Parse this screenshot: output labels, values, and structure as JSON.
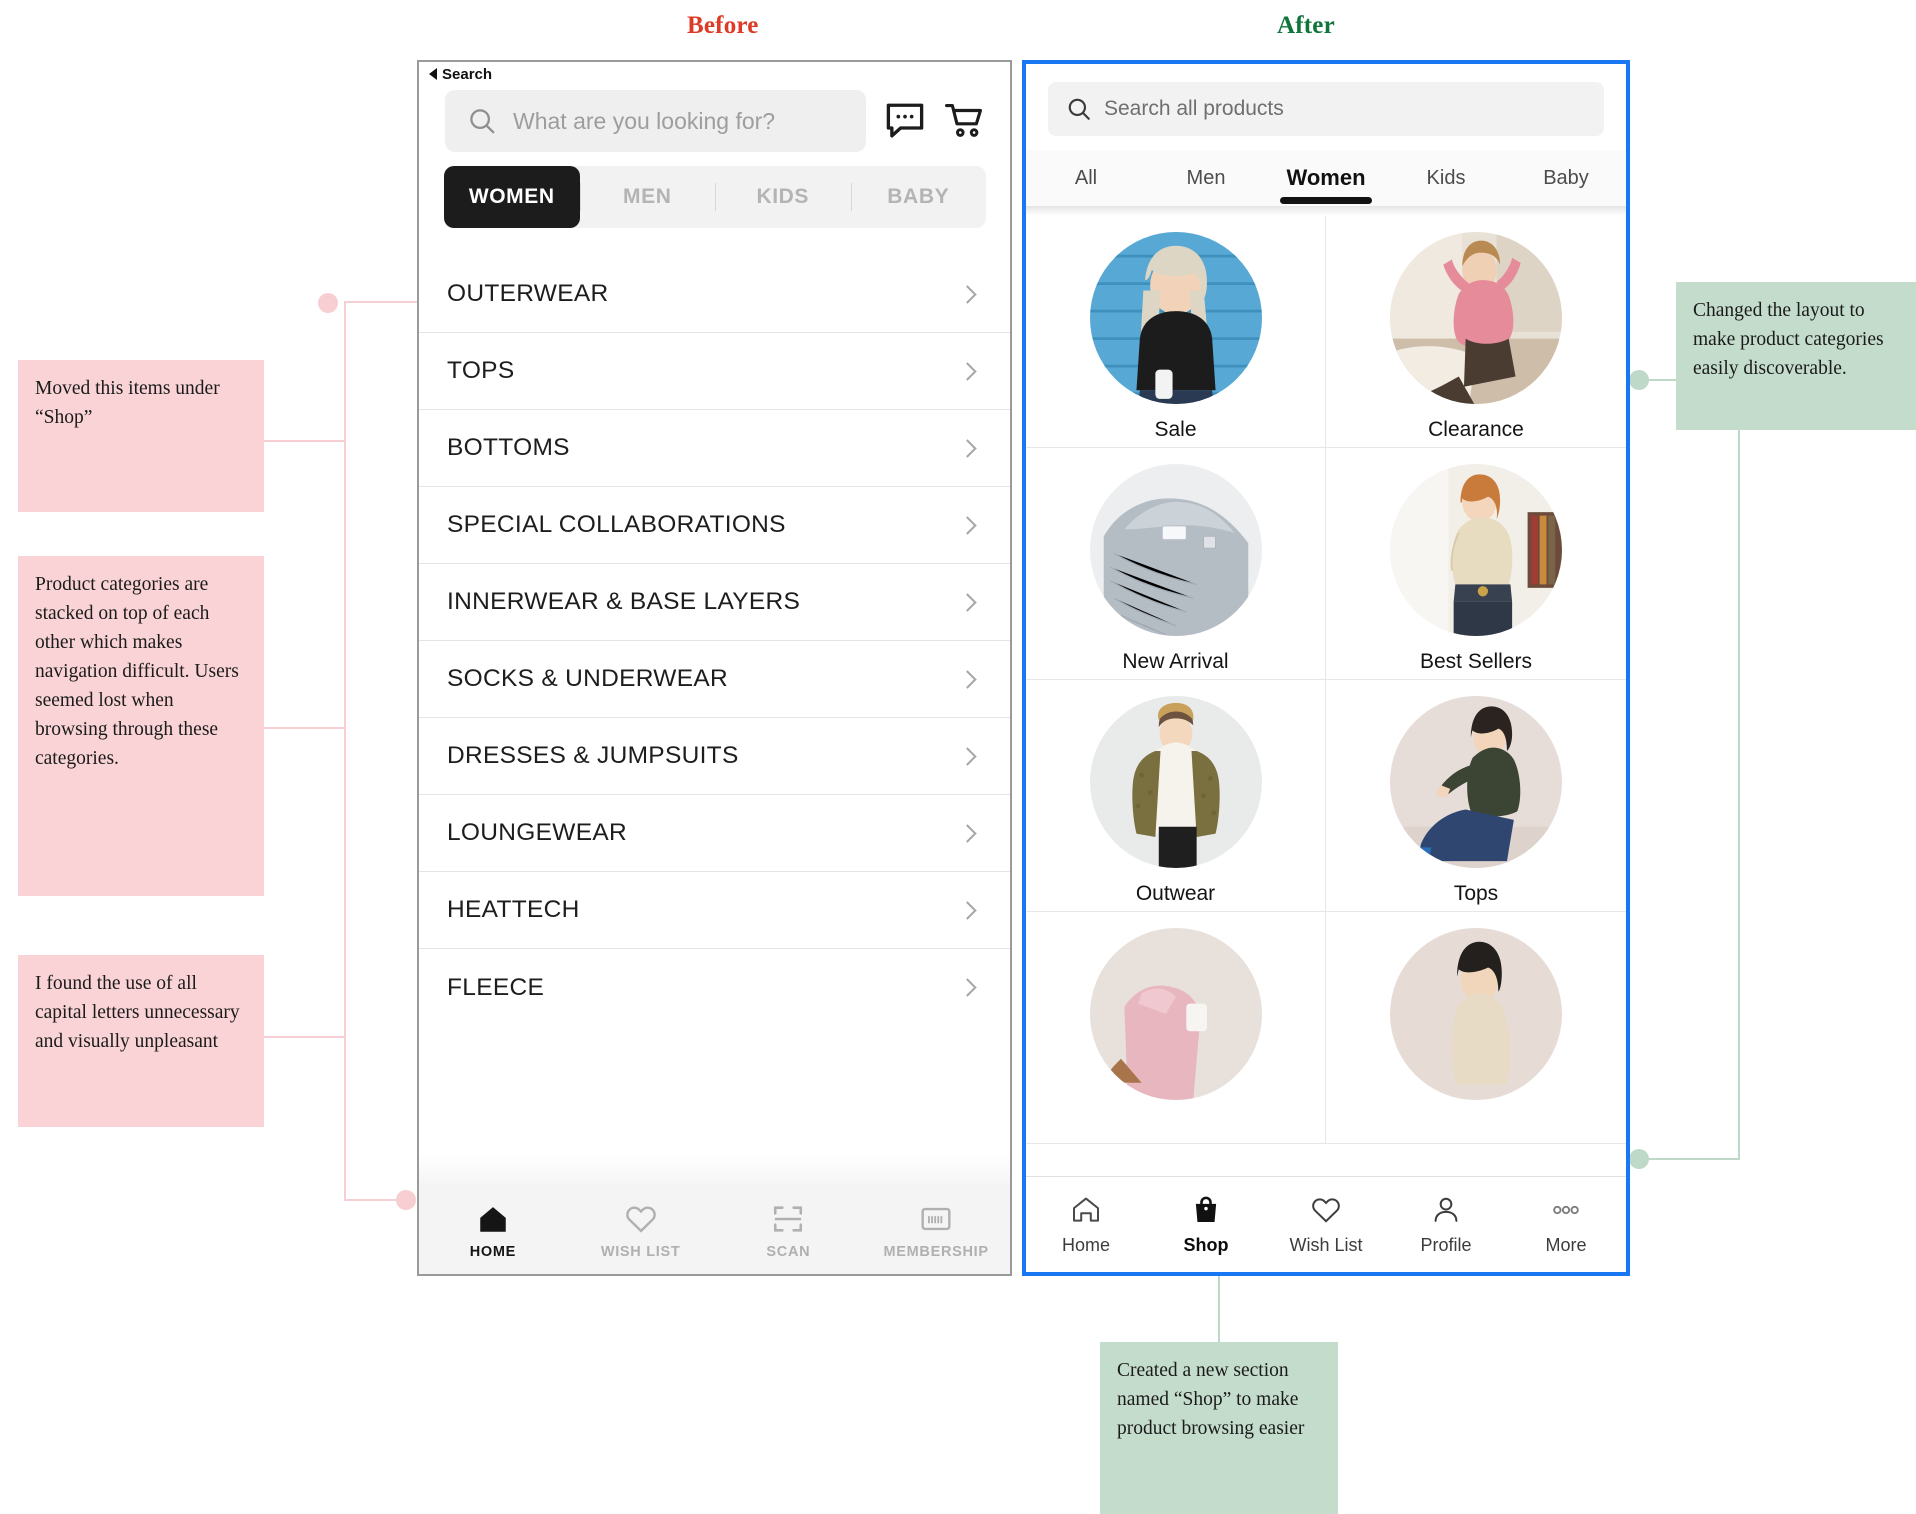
{
  "headings": {
    "before": "Before",
    "after": "After",
    "before_color": "#DE3B26",
    "after_color": "#10753A"
  },
  "annotations": {
    "pink_color": "#F9D3D5",
    "green_color": "#C3DCCB",
    "pink_notes": [
      {
        "id": "moved-items",
        "text": "Moved this items under “Shop”"
      },
      {
        "id": "stacked-categories",
        "text": "Product categories are stacked on top of each other which makes navigation difficult. Users seemed lost when browsing through these categories."
      },
      {
        "id": "all-caps",
        "text": "I found the use of all capital letters unnecessary and visually unpleasant"
      }
    ],
    "green_notes": [
      {
        "id": "layout-change",
        "text": "Changed the layout to make product categories easily discoverable."
      },
      {
        "id": "new-shop-section",
        "text": "Created a new section named “Shop” to make product browsing easier"
      }
    ]
  },
  "before_app": {
    "status_bar": {
      "back_label": "Search"
    },
    "search": {
      "placeholder": "What are you looking for?"
    },
    "header_icons": [
      "chat-icon",
      "cart-icon"
    ],
    "tabs": [
      {
        "label": "WOMEN",
        "active": true
      },
      {
        "label": "MEN",
        "active": false
      },
      {
        "label": "KIDS",
        "active": false
      },
      {
        "label": "BABY",
        "active": false
      }
    ],
    "categories": [
      "OUTERWEAR",
      "TOPS",
      "BOTTOMS",
      "SPECIAL COLLABORATIONS",
      "INNERWEAR & BASE LAYERS",
      "SOCKS & UNDERWEAR",
      "DRESSES & JUMPSUITS",
      "LOUNGEWEAR",
      "HEATTECH",
      "FLEECE"
    ],
    "tab_bar": [
      {
        "label": "HOME",
        "icon": "home-icon",
        "active": true
      },
      {
        "label": "WISH LIST",
        "icon": "heart-icon",
        "active": false
      },
      {
        "label": "SCAN",
        "icon": "scan-icon",
        "active": false
      },
      {
        "label": "MEMBERSHIP",
        "icon": "membership-card-icon",
        "active": false
      }
    ]
  },
  "after_app": {
    "search": {
      "placeholder": "Search all products"
    },
    "tabs": [
      {
        "label": "All",
        "active": false
      },
      {
        "label": "Men",
        "active": false
      },
      {
        "label": "Women",
        "active": true
      },
      {
        "label": "Kids",
        "active": false
      },
      {
        "label": "Baby",
        "active": false
      }
    ],
    "category_tiles": [
      {
        "label": "Sale",
        "image": "woman-black-tee-blue-wall"
      },
      {
        "label": "Clearance",
        "image": "woman-pink-sweater-sofa"
      },
      {
        "label": "New Arrival",
        "image": "grey-blouse-closeup"
      },
      {
        "label": "Best Sellers",
        "image": "woman-beige-shirt"
      },
      {
        "label": "Outwear",
        "image": "woman-olive-cardigan-beanie"
      },
      {
        "label": "Tops",
        "image": "woman-green-top-jeans"
      },
      {
        "label": "",
        "image": "pink-outfit-partial"
      },
      {
        "label": "",
        "image": "woman-beige-hoodie-partial"
      }
    ],
    "tab_bar": [
      {
        "label": "Home",
        "icon": "home-outline-icon",
        "active": false
      },
      {
        "label": "Shop",
        "icon": "shopping-bag-icon",
        "active": true
      },
      {
        "label": "Wish List",
        "icon": "heart-outline-icon",
        "active": false
      },
      {
        "label": "Profile",
        "icon": "person-outline-icon",
        "active": false
      },
      {
        "label": "More",
        "icon": "ellipsis-icon",
        "active": false
      }
    ]
  }
}
